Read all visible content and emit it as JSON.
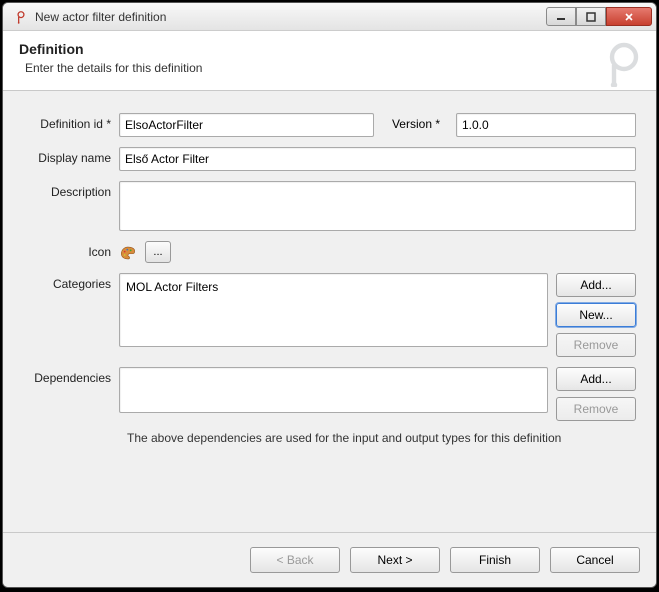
{
  "window": {
    "title": "New actor filter definition"
  },
  "header": {
    "title": "Definition",
    "subtitle": "Enter the details for this definition"
  },
  "form": {
    "definition_id_label": "Definition id *",
    "definition_id_value": "ElsoActorFilter",
    "version_label": "Version *",
    "version_value": "1.0.0",
    "display_name_label": "Display name",
    "display_name_value": "Első Actor Filter",
    "description_label": "Description",
    "description_value": "",
    "icon_label": "Icon",
    "browse_label": "...",
    "categories_label": "Categories",
    "categories": [
      "MOL Actor Filters"
    ],
    "dependencies_label": "Dependencies",
    "dependencies": [],
    "dependencies_note": "The above dependencies are used for the input and output types for this definition"
  },
  "side_buttons": {
    "add": "Add...",
    "new": "New...",
    "remove": "Remove"
  },
  "wizard": {
    "back": "< Back",
    "next": "Next >",
    "finish": "Finish",
    "cancel": "Cancel"
  }
}
